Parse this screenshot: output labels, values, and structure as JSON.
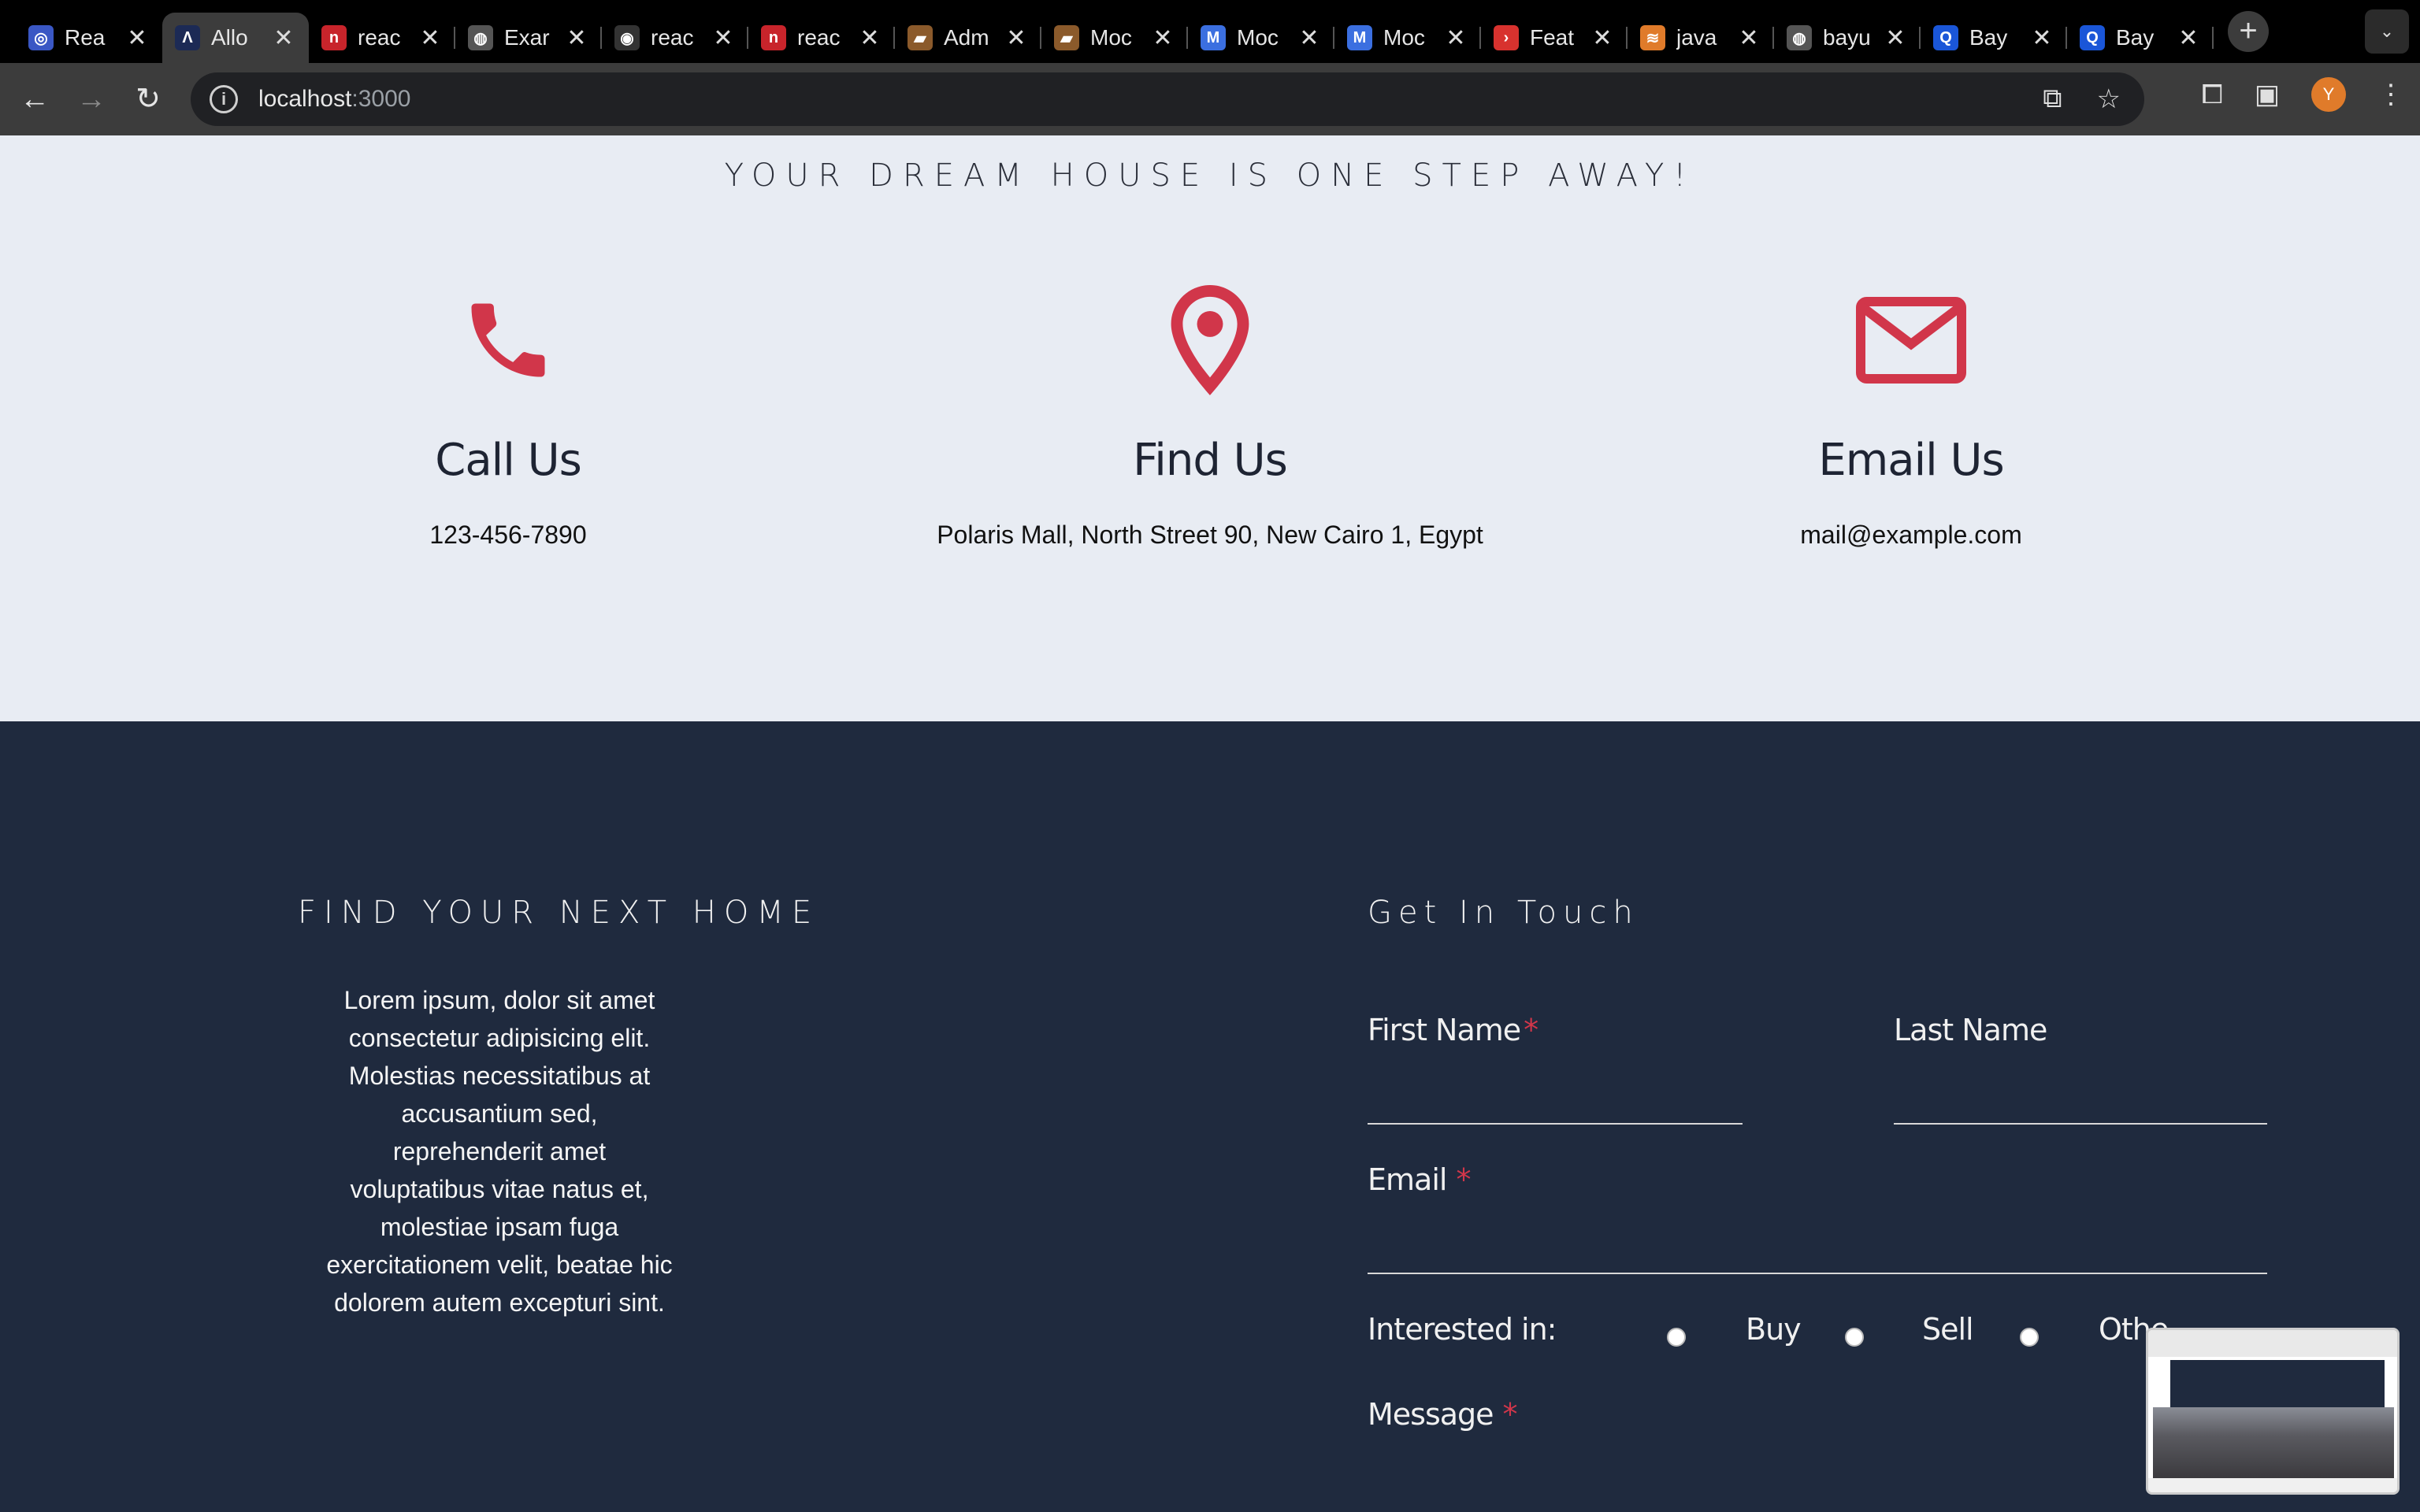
{
  "browser": {
    "tabs": [
      {
        "title": "Rea",
        "fav_color": "#3a57c4",
        "fav_glyph": "◎"
      },
      {
        "title": "Allo",
        "fav_color": "#1c2a55",
        "fav_glyph": "Λ"
      },
      {
        "title": "reac",
        "fav_color": "#c8242b",
        "fav_glyph": "n"
      },
      {
        "title": "Exar",
        "fav_color": "#555555",
        "fav_glyph": "◍"
      },
      {
        "title": "reac",
        "fav_color": "#333333",
        "fav_glyph": "◉"
      },
      {
        "title": "reac",
        "fav_color": "#c8242b",
        "fav_glyph": "n"
      },
      {
        "title": "Adm",
        "fav_color": "#8b5a2b",
        "fav_glyph": "▰"
      },
      {
        "title": "Moc",
        "fav_color": "#8b5a2b",
        "fav_glyph": "▰"
      },
      {
        "title": "Moc",
        "fav_color": "#3b6fe0",
        "fav_glyph": "M"
      },
      {
        "title": "Moc",
        "fav_color": "#3b6fe0",
        "fav_glyph": "M"
      },
      {
        "title": "Feat",
        "fav_color": "#d8322e",
        "fav_glyph": "›"
      },
      {
        "title": "java",
        "fav_color": "#e07b2a",
        "fav_glyph": "≋"
      },
      {
        "title": "bayu",
        "fav_color": "#555555",
        "fav_glyph": "◍"
      },
      {
        "title": "Bay",
        "fav_color": "#1a56d8",
        "fav_glyph": "Q"
      },
      {
        "title": "Bay",
        "fav_color": "#1a56d8",
        "fav_glyph": "Q"
      }
    ],
    "url_host": "localhost",
    "url_port": ":3000",
    "profile_initial": "Y"
  },
  "contact": {
    "tagline": "YOUR DREAM HOUSE IS ONE STEP AWAY!",
    "cards": [
      {
        "icon": "phone-icon",
        "title": "Call Us",
        "text": "123-456-7890"
      },
      {
        "icon": "location-pin-icon",
        "title": "Find Us",
        "text": "Polaris Mall, North Street 90, New Cairo 1, Egypt"
      },
      {
        "icon": "mail-icon",
        "title": "Email Us",
        "text": "mail@example.com"
      }
    ],
    "accent_color": "#d1364a"
  },
  "footer": {
    "left_heading": "FIND YOUR NEXT HOME",
    "left_text": "Lorem ipsum, dolor sit amet consectetur adipisicing elit. Molestias necessitatibus at accusantium sed, reprehenderit amet voluptatibus vitae natus et, molestiae ipsam fuga exercitationem velit, beatae hic dolorem autem excepturi sint.",
    "form_heading": "Get In Touch",
    "first_name_label": "First Name",
    "last_name_label": "Last Name",
    "email_label": "Email",
    "interested_label": "Interested in:",
    "options": [
      "Buy",
      "Sell",
      "Othe"
    ],
    "message_label": "Message",
    "required_mark": "*",
    "background_color": "#1f2a3e"
  }
}
